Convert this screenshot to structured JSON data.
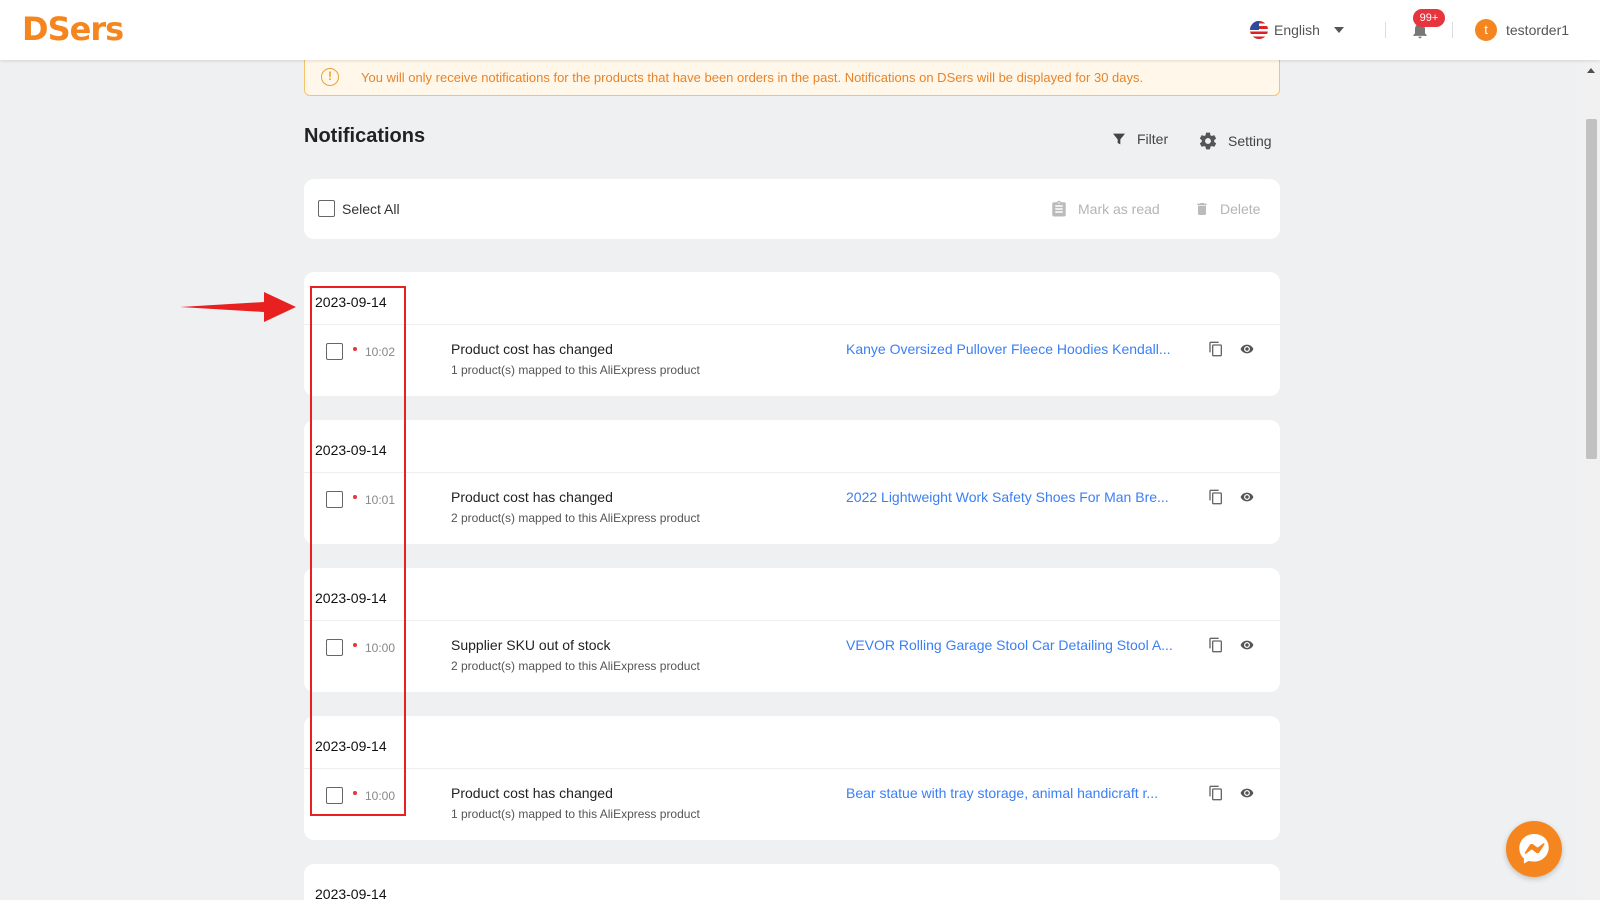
{
  "header": {
    "logo": "DSers",
    "language": "English",
    "notification_badge": "99+",
    "user_initial": "t",
    "username": "testorder1"
  },
  "notice": {
    "text": "You will only receive notifications for the products that have been orders in the past. Notifications on DSers will be displayed for 30 days."
  },
  "page_title": "Notifications",
  "tools": {
    "filter": "Filter",
    "setting": "Setting"
  },
  "toolbar": {
    "select_all": "Select All",
    "mark_as_read": "Mark as read",
    "delete": "Delete"
  },
  "groups": [
    {
      "date": "2023-09-14",
      "time": "10:02",
      "title": "Product cost has changed",
      "subtitle": "1 product(s) mapped to this AliExpress product",
      "product": "Kanye Oversized Pullover Fleece Hoodies Kendall..."
    },
    {
      "date": "2023-09-14",
      "time": "10:01",
      "title": "Product cost has changed",
      "subtitle": "2 product(s) mapped to this AliExpress product",
      "product": "2022 Lightweight Work Safety Shoes For Man Bre..."
    },
    {
      "date": "2023-09-14",
      "time": "10:00",
      "title": "Supplier SKU out of stock",
      "subtitle": "2 product(s) mapped to this AliExpress product",
      "product": "VEVOR Rolling Garage Stool Car Detailing Stool A..."
    },
    {
      "date": "2023-09-14",
      "time": "10:00",
      "title": "Product cost has changed",
      "subtitle": "1 product(s) mapped to this AliExpress product",
      "product": "Bear statue with tray storage, animal handicraft r..."
    },
    {
      "date": "2023-09-14"
    }
  ],
  "colors": {
    "brand": "#f5861f",
    "link": "#3a7ff5",
    "badge": "#e8343c",
    "annotation": "#e8201f"
  }
}
